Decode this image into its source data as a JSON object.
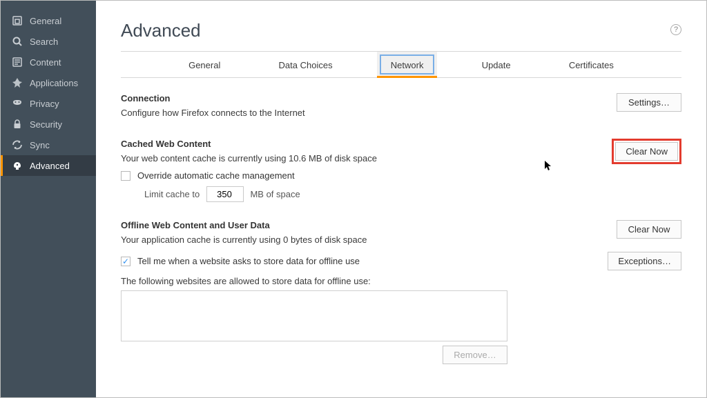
{
  "sidebar": {
    "items": [
      {
        "label": "General"
      },
      {
        "label": "Search"
      },
      {
        "label": "Content"
      },
      {
        "label": "Applications"
      },
      {
        "label": "Privacy"
      },
      {
        "label": "Security"
      },
      {
        "label": "Sync"
      },
      {
        "label": "Advanced"
      }
    ]
  },
  "page": {
    "title": "Advanced"
  },
  "tabs": [
    {
      "label": "General"
    },
    {
      "label": "Data Choices"
    },
    {
      "label": "Network"
    },
    {
      "label": "Update"
    },
    {
      "label": "Certificates"
    }
  ],
  "connection": {
    "title": "Connection",
    "desc": "Configure how Firefox connects to the Internet",
    "settings_button": "Settings…"
  },
  "cache": {
    "title": "Cached Web Content",
    "status": "Your web content cache is currently using 10.6 MB of disk space",
    "clear_button": "Clear Now",
    "override_label": "Override automatic cache management",
    "override_checked": false,
    "limit_prefix": "Limit cache to",
    "limit_value": "350",
    "limit_suffix": "MB of space"
  },
  "offline": {
    "title": "Offline Web Content and User Data",
    "status": "Your application cache is currently using 0 bytes of disk space",
    "clear_button": "Clear Now",
    "tell_me_label": "Tell me when a website asks to store data for offline use",
    "tell_me_checked": true,
    "exceptions_button": "Exceptions…",
    "allowed_label": "The following websites are allowed to store data for offline use:",
    "remove_button": "Remove…"
  }
}
